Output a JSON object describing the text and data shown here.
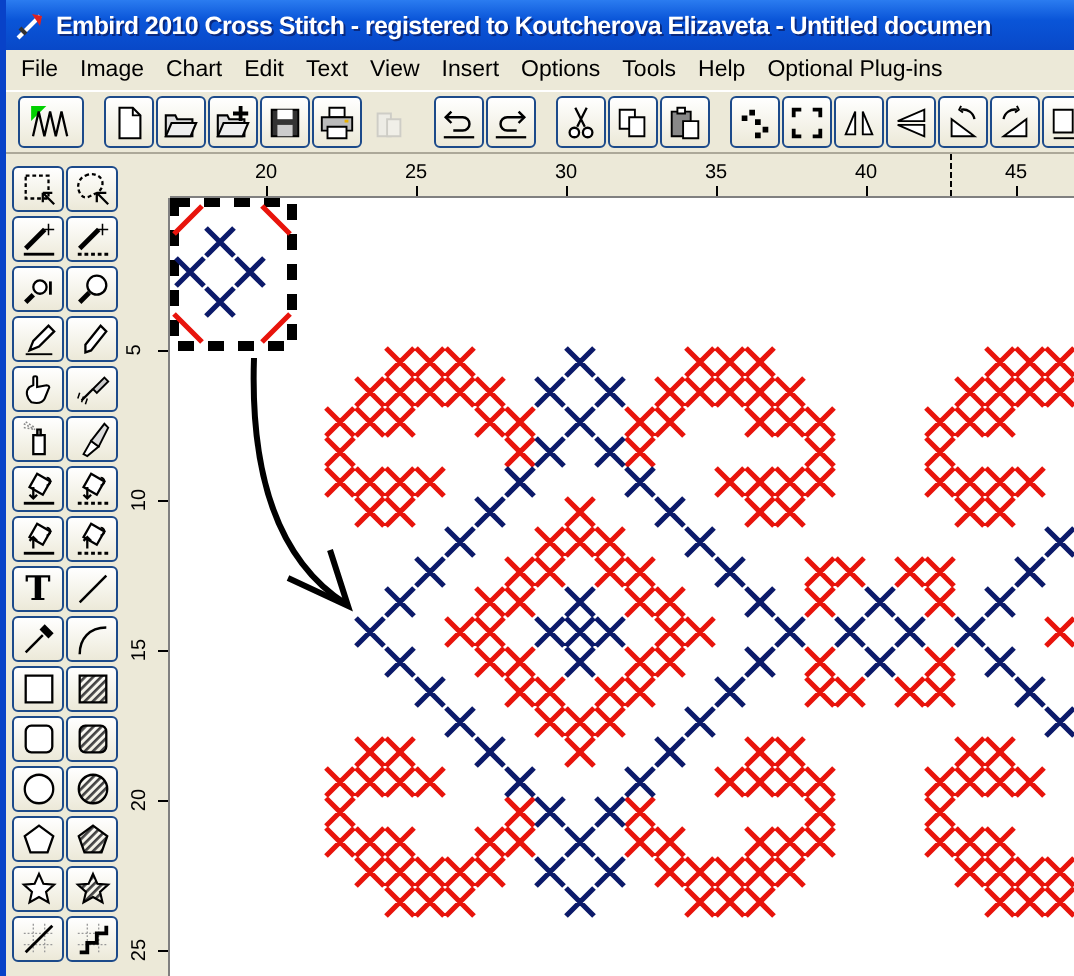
{
  "window": {
    "title": "Embird 2010 Cross Stitch - registered to Koutcherova Elizaveta - Untitled documen"
  },
  "menu": [
    "File",
    "Image",
    "Chart",
    "Edit",
    "Text",
    "View",
    "Insert",
    "Options",
    "Tools",
    "Help",
    "Optional Plug-ins"
  ],
  "toolbar": [
    {
      "disabled": false
    },
    {
      "disabled": false
    },
    {
      "disabled": false
    },
    {
      "disabled": false
    },
    {
      "disabled": false
    },
    {
      "disabled": false
    },
    {
      "disabled": true
    },
    {
      "disabled": false
    },
    {
      "disabled": false
    },
    {
      "disabled": false
    },
    {
      "disabled": false
    },
    {
      "disabled": false
    },
    {
      "disabled": false
    },
    {
      "disabled": false
    },
    {
      "disabled": false
    },
    {
      "disabled": false
    },
    {
      "disabled": false
    },
    {
      "disabled": false
    },
    {
      "disabled": false
    }
  ],
  "tool_palette": {
    "text_tool_glyph": "T"
  },
  "rulers": {
    "horizontal": [
      "20",
      "25",
      "30",
      "35",
      "40",
      "45"
    ],
    "vertical": [
      "5",
      "10",
      "15",
      "20",
      "25"
    ]
  }
}
